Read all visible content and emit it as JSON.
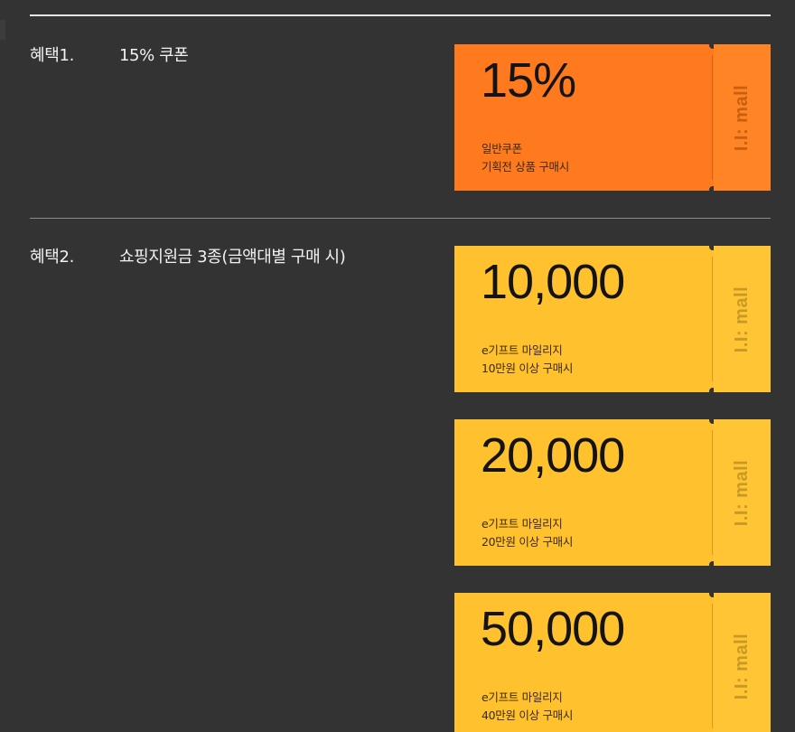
{
  "colors": {
    "background": "#333333",
    "coupon_orange": "#ff7a1f",
    "coupon_orange_stub": "#ff8426",
    "coupon_yellow": "#ffc12e",
    "coupon_yellow_stub": "#ffc535",
    "brand_on_orange": "#c86010",
    "brand_on_yellow": "#c79a25"
  },
  "benefits": [
    {
      "num": "혜택1.",
      "title": "15% 쿠폰",
      "coupons": [
        {
          "amount": "15%",
          "line1": "일반쿠폰",
          "line2": "기획전 상품 구매시",
          "brand": "I.I: mall",
          "color": "orange"
        }
      ]
    },
    {
      "num": "혜택2.",
      "title": "쇼핑지원금 3종(금액대별 구매 시)",
      "coupons": [
        {
          "amount": "10,000",
          "line1": "e기프트 마일리지",
          "line2": "10만원 이상 구매시",
          "brand": "I.I: mall",
          "color": "yellow"
        },
        {
          "amount": "20,000",
          "line1": "e기프트 마일리지",
          "line2": "20만원 이상 구매시",
          "brand": "I.I: mall",
          "color": "yellow"
        },
        {
          "amount": "50,000",
          "line1": "e기프트 마일리지",
          "line2": "40만원 이상 구매시",
          "brand": "I.I: mall",
          "color": "yellow"
        }
      ]
    }
  ]
}
